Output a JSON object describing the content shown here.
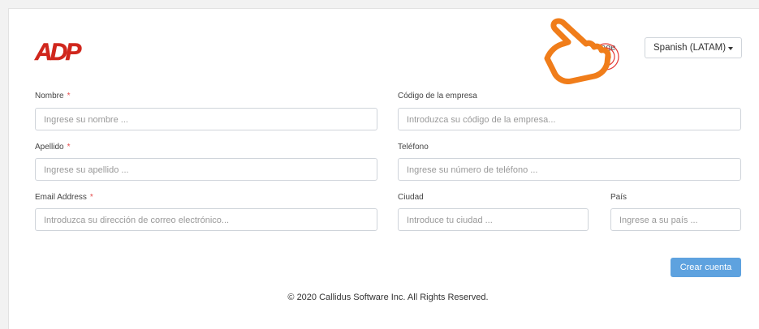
{
  "brand": {
    "logo_text": "ADP",
    "logo_color": "#d0271d"
  },
  "language": {
    "label": "uage",
    "selected": "Spanish (LATAM)"
  },
  "form": {
    "nombre": {
      "label": "Nombre",
      "required": "*",
      "placeholder": "Ingrese su nombre ..."
    },
    "codigo": {
      "label": "Código de la empresa",
      "placeholder": "Introduzca su código de la empresa..."
    },
    "apellido": {
      "label": "Apellido",
      "required": "*",
      "placeholder": "Ingrese su apellido ..."
    },
    "telefono": {
      "label": "Teléfono",
      "placeholder": "Ingrese su número de teléfono ..."
    },
    "email": {
      "label": "Email Address",
      "required": "*",
      "placeholder": "Introduzca su dirección de correo electrónico..."
    },
    "ciudad": {
      "label": "Ciudad",
      "placeholder": "Introduce tu ciudad ..."
    },
    "pais": {
      "label": "País",
      "placeholder": "Ingrese a su país ..."
    },
    "submit_label": "Crear cuenta"
  },
  "footer": {
    "text": "© 2020 Callidus Software Inc. All Rights Reserved."
  },
  "colors": {
    "accent": "#5ea2df",
    "required": "#e64b4b",
    "cursor": "#f07d1a"
  }
}
